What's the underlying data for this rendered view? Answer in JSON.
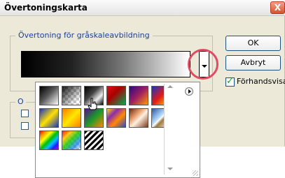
{
  "window": {
    "title": "Övertoningskarta",
    "close_glyph": "X"
  },
  "gradient_group": {
    "label": "Övertoning för gråskaleavbildning",
    "preview_gradient": [
      "#000000",
      "#222222",
      "#777777",
      "#ffffff"
    ]
  },
  "buttons": {
    "ok_label": "OK",
    "cancel_label": "Avbryt"
  },
  "preview": {
    "label": "Förhandsvisa",
    "checked": true
  },
  "options_group": {
    "label": "O"
  },
  "swatch_picker": {
    "swatches": [
      {
        "name": "black-white"
      },
      {
        "name": "transparent-checker"
      },
      {
        "name": "black-gray-white"
      },
      {
        "name": "red-green"
      },
      {
        "name": "violet-orange"
      },
      {
        "name": "blue-red-yellow"
      },
      {
        "name": "blue-yellow-blue"
      },
      {
        "name": "orange-yellow-orange"
      },
      {
        "name": "violet-green-orange"
      },
      {
        "name": "yellow-violet-orange-blue"
      },
      {
        "name": "copper"
      },
      {
        "name": "chrome"
      },
      {
        "name": "spectrum"
      },
      {
        "name": "transparent-rainbow"
      },
      {
        "name": "transparent-stripes"
      }
    ],
    "highlight_color": "#e24a61"
  },
  "icons": {
    "menu": "right-arrow-circle-icon",
    "close": "close-icon",
    "dropdown": "chevron-down-icon",
    "cursor": "hand-pointer-icon"
  }
}
